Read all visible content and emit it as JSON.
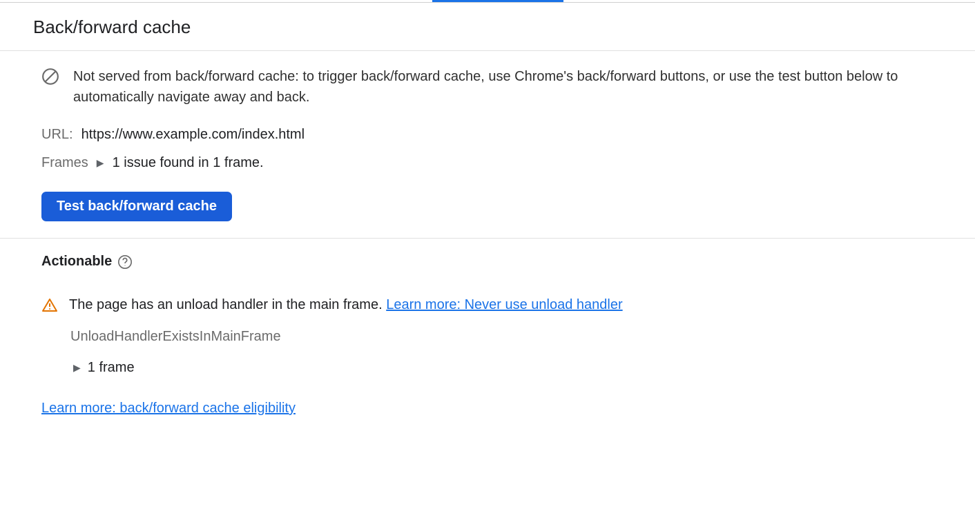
{
  "header": {
    "title": "Back/forward cache"
  },
  "main": {
    "info_message": "Not served from back/forward cache: to trigger back/forward cache, use Chrome's back/forward buttons, or use the test button below to automatically navigate away and back.",
    "url_label": "URL:",
    "url_value": "https://www.example.com/index.html",
    "frames_label": "Frames",
    "frames_summary": "1 issue found in 1 frame.",
    "test_button": "Test back/forward cache"
  },
  "actionable": {
    "heading": "Actionable",
    "issue_text": "The page has an unload handler in the main frame. ",
    "issue_link": "Learn more: Never use unload handler",
    "issue_code": "UnloadHandlerExistsInMainFrame",
    "frame_count": "1 frame",
    "bottom_link": "Learn more: back/forward cache eligibility"
  }
}
